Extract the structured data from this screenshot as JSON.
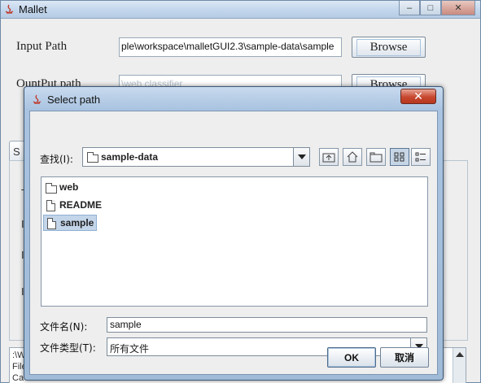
{
  "main_window": {
    "title": "Mallet",
    "minimize_icon": "minimize-icon",
    "maximize_icon": "maximize-icon",
    "close_icon": "close-icon",
    "input_path_label": "Input Path",
    "input_path_value": "ple\\workspace\\malletGUI2.3\\sample-data\\sample",
    "output_path_label": "OuntPut path",
    "output_path_value": "\\web classifier",
    "browse_label": "Browse",
    "browse2_label": "Browse",
    "tab_stub": "S",
    "log_lines": [
      ":\\W",
      "File",
      "Ca"
    ]
  },
  "dialog": {
    "title": "Select path",
    "close_label": "✕",
    "look_in_label": "查找(I):",
    "look_in_value": "sample-data",
    "toolbar_icons": [
      "up-one-level-icon",
      "home-icon",
      "new-folder-icon",
      "list-view-icon",
      "details-view-icon"
    ],
    "files": [
      {
        "name": "web",
        "type": "folder"
      },
      {
        "name": "README",
        "type": "file"
      },
      {
        "name": "sample",
        "type": "file",
        "selected": true
      }
    ],
    "filename_label": "文件名(N):",
    "filename_value": "sample",
    "filetype_label": "文件类型(T):",
    "filetype_value": "所有文件",
    "ok_label": "OK",
    "cancel_label": "取消"
  }
}
